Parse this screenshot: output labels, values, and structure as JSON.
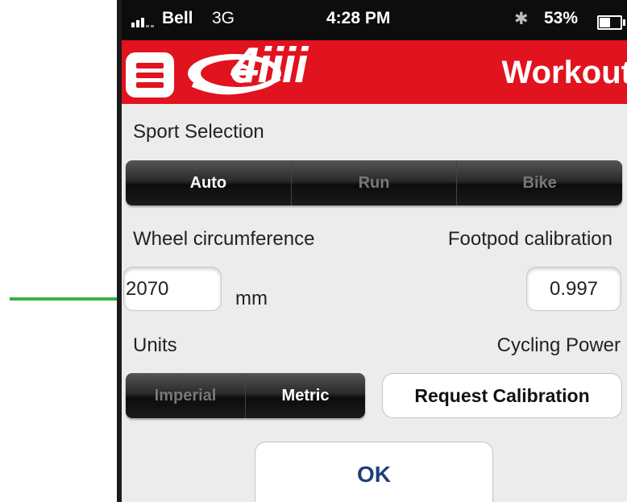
{
  "status_bar": {
    "carrier": "Bell",
    "network": "3G",
    "time": "4:28 PM",
    "bluetooth_icon": "bluetooth-icon",
    "battery_percent": "53%",
    "battery_level": 0.53
  },
  "header": {
    "menu_icon": "hamburger-menu-icon",
    "logo_text": "4iiii",
    "title": "Workout"
  },
  "sport_selection": {
    "label": "Sport Selection",
    "options": [
      "Auto",
      "Run",
      "Bike"
    ],
    "selected": "Auto"
  },
  "wheel": {
    "label": "Wheel circumference",
    "value": "2070",
    "unit": "mm"
  },
  "footpod": {
    "label": "Footpod calibration",
    "value": "0.997"
  },
  "units": {
    "label": "Units",
    "options": [
      "Imperial",
      "Metric"
    ],
    "selected": "Metric"
  },
  "cycling_power": {
    "label": "Cycling Power",
    "button": "Request Calibration"
  },
  "ok_button": "OK",
  "colors": {
    "header_red": "#e1131f",
    "annotation_arrow": "#3cb043",
    "ok_text": "#1f3e7a"
  }
}
